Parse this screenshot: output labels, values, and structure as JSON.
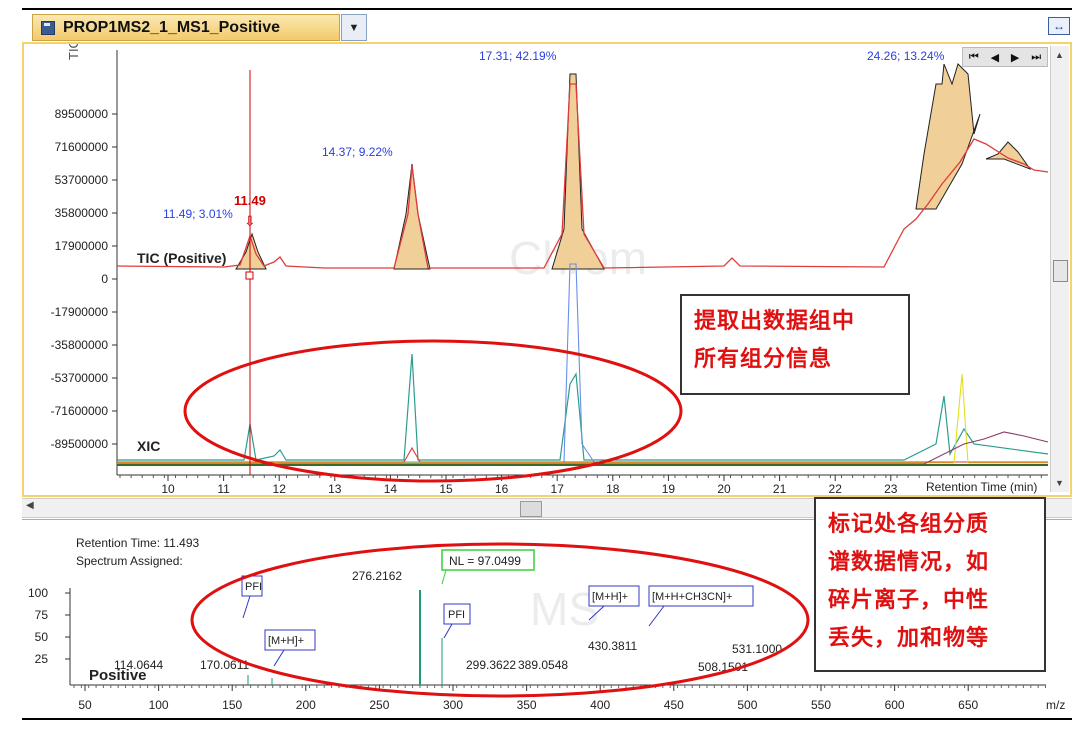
{
  "window": {
    "tab_title": "PROP1MS2_1_MS1_Positive"
  },
  "chromatogram": {
    "y_axis_label": "TIC",
    "y_ticks": [
      "89500000",
      "71600000",
      "53700000",
      "35800000",
      "17900000",
      "0",
      "-17900000",
      "-35800000",
      "-53700000",
      "-71600000",
      "-89500000"
    ],
    "x_ticks": [
      "10",
      "11",
      "12",
      "13",
      "14",
      "15",
      "16",
      "17",
      "18",
      "19",
      "20",
      "21",
      "22",
      "23"
    ],
    "x_axis_label": "Retention Time (min)",
    "watermark": "Chrom",
    "trace_label_tic": "TIC (Positive)",
    "trace_label_xic": "XIC",
    "cursor_label": "11.49",
    "peak_labels": [
      "11.49; 3.01%",
      "14.37; 9.22%",
      "17.31; 42.19%",
      "24.26; 13.24%"
    ],
    "annotation": [
      "提取出数据组中",
      "所有组分信息"
    ],
    "colors": {
      "tic_trace": "#e03c3c",
      "peak_fill": "#f0cf98",
      "peak_label": "#2a3fe0",
      "cursor": "#cc0000",
      "highlight_ellipse": "#e01010",
      "border": "#f3d46a"
    }
  },
  "spectrum": {
    "retention_time": "Retention Time: 11.493",
    "assigned": "Spectrum Assigned:",
    "y_ticks": [
      "100",
      "75",
      "50",
      "25"
    ],
    "x_ticks": [
      "50",
      "100",
      "150",
      "200",
      "250",
      "300",
      "350",
      "400",
      "450",
      "500",
      "550",
      "600",
      "650"
    ],
    "x_axis_label": "m/z",
    "polarity": "Positive",
    "watermark": "MS",
    "nl_label": "NL = 97.0499",
    "peak_labels": [
      "114.0644",
      "170.0611",
      "276.2162",
      "299.3622",
      "389.0548",
      "430.3811",
      "508.1501",
      "531.1000"
    ],
    "callouts": [
      "PFI",
      "[M+H]+",
      "PFI",
      "[M+H]+",
      "[M+H+CH3CN]+"
    ],
    "annotation": [
      "标记处各组分质",
      "谱数据情况，如",
      "碎片离子，中性",
      "丢失，加和物等"
    ]
  }
}
